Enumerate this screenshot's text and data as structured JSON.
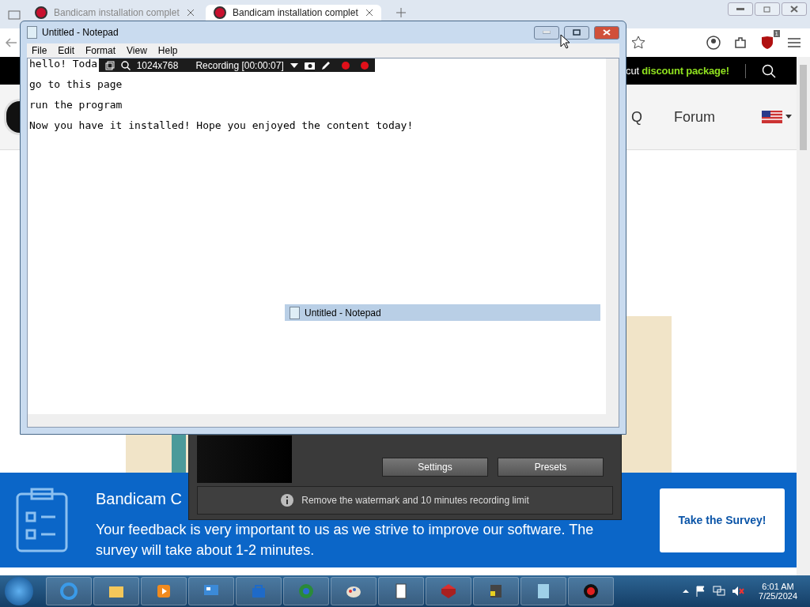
{
  "browser": {
    "tabs": [
      {
        "title": "Bandicam installation complet",
        "selected": false
      },
      {
        "title": "Bandicam installation complet",
        "selected": true
      }
    ],
    "extension_badge": "1",
    "promo": {
      "text": "cut",
      "highlight": "discount package!"
    },
    "nav": [
      "Q",
      "Forum"
    ],
    "survey": {
      "heading": "Bandicam C",
      "body": "Your feedback is very important to us as we strive to improve our software. The survey will take about 1-2 minutes.",
      "button": "Take the Survey!"
    }
  },
  "notepad": {
    "title": "Untitled - Notepad",
    "menu": [
      "File",
      "Edit",
      "Format",
      "View",
      "Help"
    ],
    "lines": [
      "hello! Toda",
      "go to this page",
      "run the program",
      "Now you have it installed! Hope you enjoyed the content today!"
    ]
  },
  "recording_bar": {
    "resolution": "1024x768",
    "status": "Recording [00:00:07]"
  },
  "bandicam": {
    "buttons": [
      "Settings",
      "Presets"
    ],
    "notice": "Remove the watermark and 10 minutes recording limit"
  },
  "thumbnail": {
    "title": "Untitled - Notepad"
  },
  "taskbar": {
    "apps": [
      {
        "kind": "browser"
      },
      {
        "kind": "folder"
      },
      {
        "kind": "media"
      },
      {
        "kind": "panel"
      },
      {
        "kind": "store"
      },
      {
        "kind": "globe"
      },
      {
        "kind": "paint"
      },
      {
        "kind": "cards"
      },
      {
        "kind": "cube"
      },
      {
        "kind": "tool"
      },
      {
        "kind": "notepad"
      },
      {
        "kind": "record"
      }
    ],
    "time": "6:01 AM",
    "date": "7/25/2024"
  }
}
